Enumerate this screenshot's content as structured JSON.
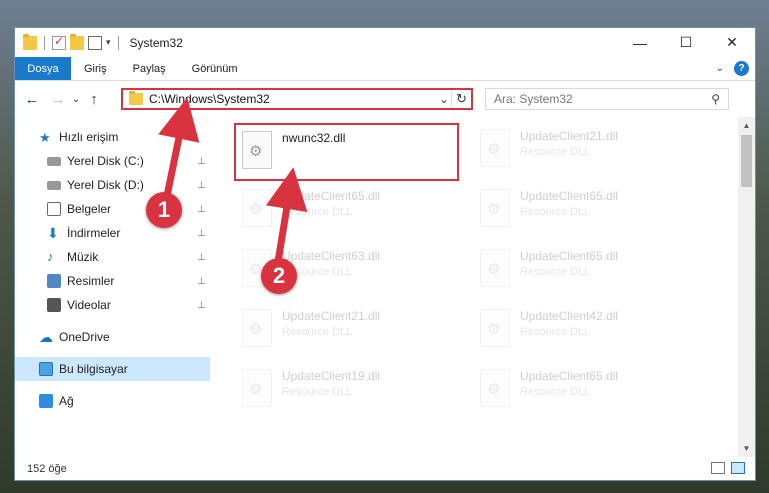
{
  "window": {
    "title": "System32",
    "controls": {
      "minimize": "—",
      "maximize": "☐",
      "close": "✕"
    }
  },
  "ribbon": {
    "tabs": [
      "Dosya",
      "Giriş",
      "Paylaş",
      "Görünüm"
    ],
    "expand_glyph": "⌄",
    "help_glyph": "?"
  },
  "nav": {
    "back": "←",
    "forward": "→",
    "recent": "⌄",
    "up": "↑",
    "address_path": "C:\\Windows\\System32",
    "address_dropdown": "⌄",
    "refresh": "↻",
    "search_placeholder": "Ara: System32",
    "search_glyph": "⚲"
  },
  "sidebar": {
    "items": [
      {
        "label": "Hızlı erişim",
        "icon": "star-icon"
      },
      {
        "label": "Yerel Disk (C:)",
        "icon": "drive-icon",
        "pinned": true
      },
      {
        "label": "Yerel Disk (D:)",
        "icon": "drive-icon",
        "pinned": true
      },
      {
        "label": "Belgeler",
        "icon": "documents-icon",
        "pinned": true
      },
      {
        "label": "İndirmeler",
        "icon": "downloads-icon",
        "pinned": true
      },
      {
        "label": "Müzik",
        "icon": "music-icon",
        "pinned": true
      },
      {
        "label": "Resimler",
        "icon": "pictures-icon",
        "pinned": true
      },
      {
        "label": "Videolar",
        "icon": "videos-icon",
        "pinned": true
      },
      {
        "label": "OneDrive",
        "icon": "onedrive-icon"
      },
      {
        "label": "Bu bilgisayar",
        "icon": "this-pc-icon",
        "selected": true
      },
      {
        "label": "Ağ",
        "icon": "network-icon"
      }
    ],
    "pin_glyph": "📌"
  },
  "files": {
    "highlighted": {
      "name": "nwunc32.dll",
      "type": ""
    },
    "faded": [
      {
        "name": "UpdateClient21.dll",
        "type": "Resource DLL"
      },
      {
        "name": "UpdateClient65.dll",
        "type": "Resource DLL"
      },
      {
        "name": "UpdateClient65.dll",
        "type": "Resource DLL"
      },
      {
        "name": "UpdateClient63.dll",
        "type": "Resource DLL"
      },
      {
        "name": "UpdateClient65.dll",
        "type": "Resource DLL"
      },
      {
        "name": "UpdateClient21.dll",
        "type": "Resource DLL"
      },
      {
        "name": "UpdateClient42.dll",
        "type": "Resource DLL"
      },
      {
        "name": "UpdateClient19.dll",
        "type": "Resource DLL"
      },
      {
        "name": "UpdateClient65.dll",
        "type": "Resource DLL"
      }
    ]
  },
  "status": {
    "item_count": "152 öğe"
  },
  "annotations": {
    "step1": "1",
    "step2": "2",
    "color": "#d9333f"
  }
}
